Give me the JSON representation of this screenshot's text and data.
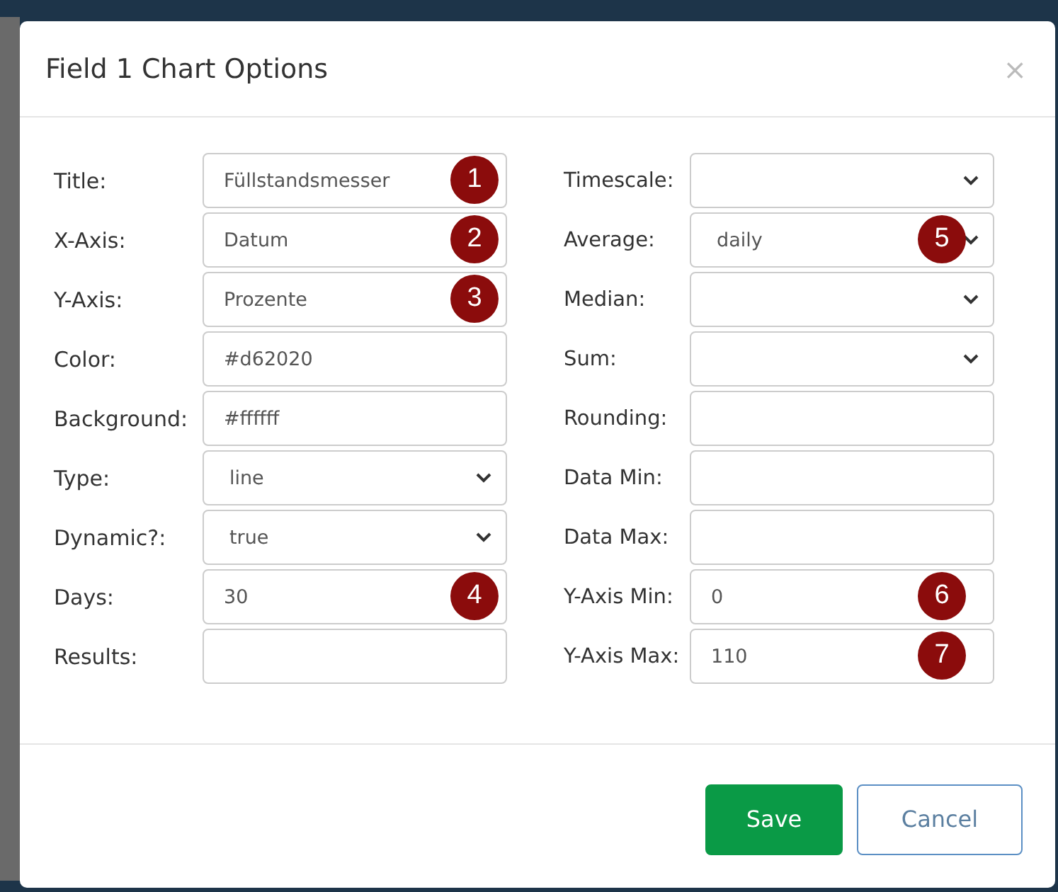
{
  "dialog": {
    "title": "Field 1 Chart Options",
    "close": "×",
    "left_fields": [
      {
        "label": "Title:",
        "kind": "text",
        "value": "Füllstandsmesser",
        "marker": "1"
      },
      {
        "label": "X-Axis:",
        "kind": "text",
        "value": "Datum",
        "marker": "2"
      },
      {
        "label": "Y-Axis:",
        "kind": "text",
        "value": "Prozente",
        "marker": "3"
      },
      {
        "label": "Color:",
        "kind": "text",
        "value": "#d62020"
      },
      {
        "label": "Background:",
        "kind": "text",
        "value": "#ffffff"
      },
      {
        "label": "Type:",
        "kind": "select",
        "value": "line"
      },
      {
        "label": "Dynamic?:",
        "kind": "select",
        "value": "true"
      },
      {
        "label": "Days:",
        "kind": "text",
        "value": "30",
        "marker": "4"
      },
      {
        "label": "Results:",
        "kind": "text"
      }
    ],
    "right_fields": [
      {
        "label": "Timescale:",
        "kind": "select"
      },
      {
        "label": "Average:",
        "kind": "select",
        "value": "daily",
        "marker": "5"
      },
      {
        "label": "Median:",
        "kind": "select"
      },
      {
        "label": "Sum:",
        "kind": "select"
      },
      {
        "label": "Rounding:",
        "kind": "text"
      },
      {
        "label": "Data Min:",
        "kind": "text"
      },
      {
        "label": "Data Max:",
        "kind": "text"
      },
      {
        "label": "Y-Axis Min:",
        "kind": "text",
        "value": "0",
        "marker": "6"
      },
      {
        "label": "Y-Axis Max:",
        "kind": "text",
        "value": "110",
        "marker": "7"
      }
    ],
    "buttons": [
      {
        "label": "Save",
        "kind": "primary"
      },
      {
        "label": "Cancel",
        "kind": "secondary"
      }
    ]
  }
}
